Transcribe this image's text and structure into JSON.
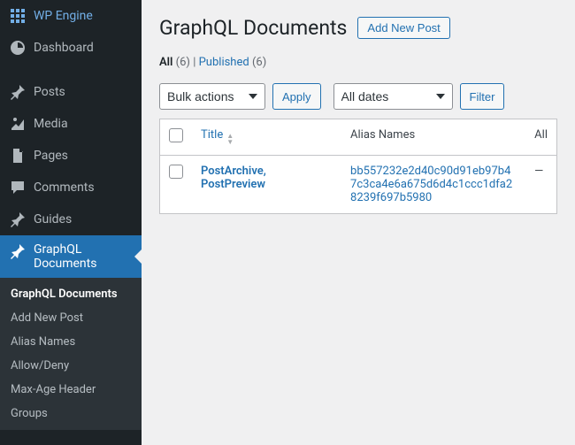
{
  "sidebar": {
    "brand": "WP Engine",
    "items": [
      {
        "label": "Dashboard"
      },
      {
        "label": "Posts"
      },
      {
        "label": "Media"
      },
      {
        "label": "Pages"
      },
      {
        "label": "Comments"
      },
      {
        "label": "Guides"
      },
      {
        "label": "GraphQL Documents"
      }
    ],
    "submenu": [
      {
        "label": "GraphQL Documents"
      },
      {
        "label": "Add New Post"
      },
      {
        "label": "Alias Names"
      },
      {
        "label": "Allow/Deny"
      },
      {
        "label": "Max-Age Header"
      },
      {
        "label": "Groups"
      }
    ]
  },
  "page": {
    "title": "GraphQL Documents",
    "add_button": "Add New Post"
  },
  "views": {
    "all_label": "All",
    "all_count": "(6)",
    "sep": "  |  ",
    "published_label": "Published",
    "published_count": "(6)"
  },
  "filters": {
    "bulk": "Bulk actions",
    "apply": "Apply",
    "dates": "All dates",
    "filter": "Filter"
  },
  "columns": {
    "title": "Title",
    "alias": "Alias Names",
    "allow": "All"
  },
  "row": {
    "title": "PostArchive, PostPreview",
    "alias": "bb557232e2d40c90d91eb97b47c3ca4e6a675d6d4c1ccc1dfa28239f697b5980",
    "allow": "—"
  }
}
